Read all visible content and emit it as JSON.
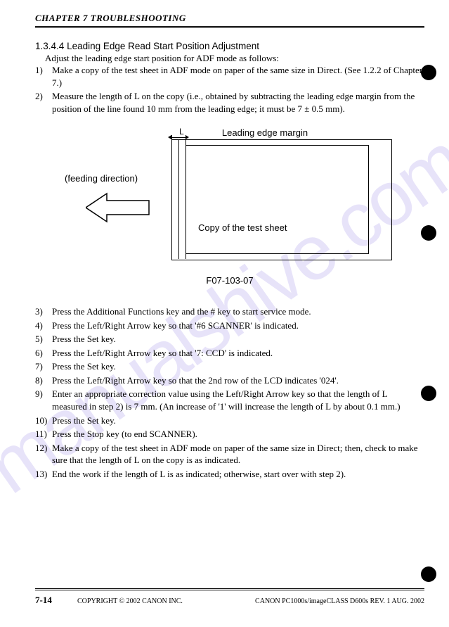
{
  "header": "CHAPTER 7 TROUBLESHOOTING",
  "section": {
    "number": "1.3.4.4",
    "title": "Leading Edge Read Start Position Adjustment",
    "intro": "Adjust the leading edge start position for ADF mode as follows:"
  },
  "top_items": [
    {
      "num": "1)",
      "text": "Make a copy of the test sheet in ADF mode on paper of the same size in Direct. (See 1.2.2 of Chapter 7.)"
    },
    {
      "num": "2)",
      "text": "Measure the length of L on the copy (i.e., obtained by subtracting the leading edge margin from the position of the line found 10 mm from the leading edge; it must be 7 ± 0.5 mm)."
    }
  ],
  "diagram": {
    "top_label": "Leading edge margin",
    "l_label": "L",
    "feed_label": "(feeding direction)",
    "copy_label": "Copy of the test sheet",
    "fig_num": "F07-103-07"
  },
  "bottom_items": [
    {
      "num": "3)",
      "text": "Press the Additional Functions key and the # key to start service mode."
    },
    {
      "num": "4)",
      "text": "Press the Left/Right Arrow key so that '#6 SCANNER' is indicated."
    },
    {
      "num": "5)",
      "text": "Press the Set key."
    },
    {
      "num": "6)",
      "text": "Press the Left/Right Arrow key so that '7: CCD' is indicated."
    },
    {
      "num": "7)",
      "text": "Press the Set key."
    },
    {
      "num": "8)",
      "text": "Press the Left/Right Arrow key so that the 2nd row of the LCD indicates '024'."
    },
    {
      "num": "9)",
      "text": "Enter an appropriate correction value using the Left/Right Arrow key so that the length of L measured in step 2) is 7 mm. (An increase of '1' will increase the length of L by about 0.1 mm.)"
    },
    {
      "num": "10)",
      "text": "Press the Set key."
    },
    {
      "num": "11)",
      "text": "Press the Stop key (to end SCANNER)."
    },
    {
      "num": "12)",
      "text": "Make a copy of the test sheet in ADF mode on paper of the same size in Direct; then, check to make sure that the length of L on the copy is as indicated."
    },
    {
      "num": "13)",
      "text": "End the work if the length of L is as indicated; otherwise, start over with step 2)."
    }
  ],
  "footer": {
    "page": "7-14",
    "copyright": "COPYRIGHT © 2002 CANON INC.",
    "revision": "CANON PC1000s/imageCLASS D600s REV. 1 AUG. 2002"
  },
  "watermark": "manualshive.com"
}
